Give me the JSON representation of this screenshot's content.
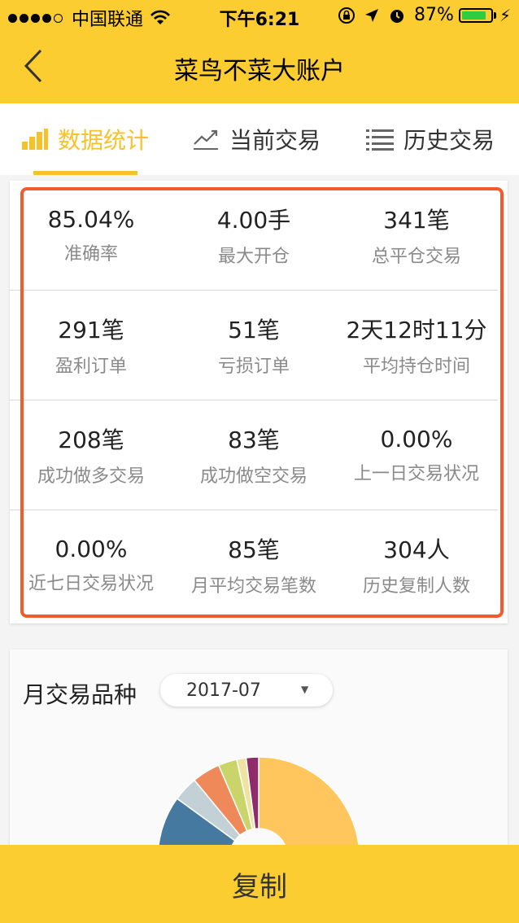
{
  "status_bar": {
    "carrier": "中国联通",
    "time": "下午6:21",
    "battery_percent": "87%"
  },
  "nav": {
    "title": "菜鸟不菜大账户"
  },
  "tabs": [
    {
      "label": "数据统计"
    },
    {
      "label": "当前交易"
    },
    {
      "label": "历史交易"
    }
  ],
  "stats": [
    {
      "value": "85.04%",
      "label": "准确率"
    },
    {
      "value": "4.00手",
      "label": "最大开仓"
    },
    {
      "value": "341笔",
      "label": "总平仓交易"
    },
    {
      "value": "291笔",
      "label": "盈利订单"
    },
    {
      "value": "51笔",
      "label": "亏损订单"
    },
    {
      "value": "2天12时11分",
      "label": "平均持仓时间"
    },
    {
      "value": "208笔",
      "label": "成功做多交易"
    },
    {
      "value": "83笔",
      "label": "成功做空交易"
    },
    {
      "value": "0.00%",
      "label": "上一日交易状况"
    },
    {
      "value": "0.00%",
      "label": "近七日交易状况"
    },
    {
      "value": "85笔",
      "label": "月平均交易笔数"
    },
    {
      "value": "304人",
      "label": "历史复制人数"
    }
  ],
  "monthly": {
    "title": "月交易品种",
    "selected_month": "2017-07"
  },
  "colors": {
    "brand_yellow": "#fbcd31",
    "highlight_red": "#f25b2e"
  },
  "bottom_button": {
    "label": "复制"
  }
}
